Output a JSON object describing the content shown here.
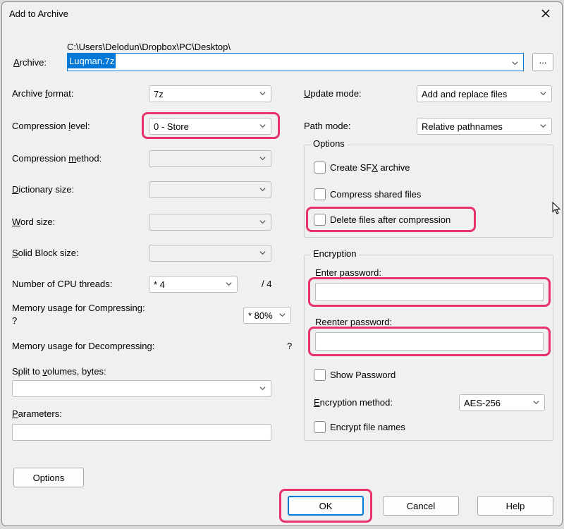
{
  "window": {
    "title": "Add to Archive"
  },
  "archive": {
    "label": "Archive:",
    "path": "C:\\Users\\Delodun\\Dropbox\\PC\\Desktop\\",
    "filename": "Luqman.7z",
    "browse": "..."
  },
  "left": {
    "format_label": "Archive format:",
    "format_value": "7z",
    "level_label": "Compression level:",
    "level_value": "0 - Store",
    "method_label": "Compression method:",
    "dict_label": "Dictionary size:",
    "word_label": "Word size:",
    "solid_label": "Solid Block size:",
    "threads_label": "Number of CPU threads:",
    "threads_value": "* 4",
    "threads_max": "/ 4",
    "mem_comp_label": "Memory usage for Compressing:",
    "mem_comp_q": "?",
    "mem_comp_value": "* 80%",
    "mem_decomp_label": "Memory usage for Decompressing:",
    "mem_decomp_q": "?",
    "split_label": "Split to volumes, bytes:",
    "params_label": "Parameters:",
    "options_btn": "Options"
  },
  "right": {
    "update_label": "Update mode:",
    "update_value": "Add and replace files",
    "pathmode_label": "Path mode:",
    "pathmode_value": "Relative pathnames",
    "options_legend": "Options",
    "sfx_label": "Create SFX archive",
    "shared_label": "Compress shared files",
    "delete_label": "Delete files after compression",
    "encryption_legend": "Encryption",
    "enter_pw": "Enter password:",
    "reenter_pw": "Reenter password:",
    "show_pw": "Show Password",
    "enc_method_label": "Encryption method:",
    "enc_method_value": "AES-256",
    "enc_names": "Encrypt file names"
  },
  "buttons": {
    "ok": "OK",
    "cancel": "Cancel",
    "help": "Help"
  }
}
